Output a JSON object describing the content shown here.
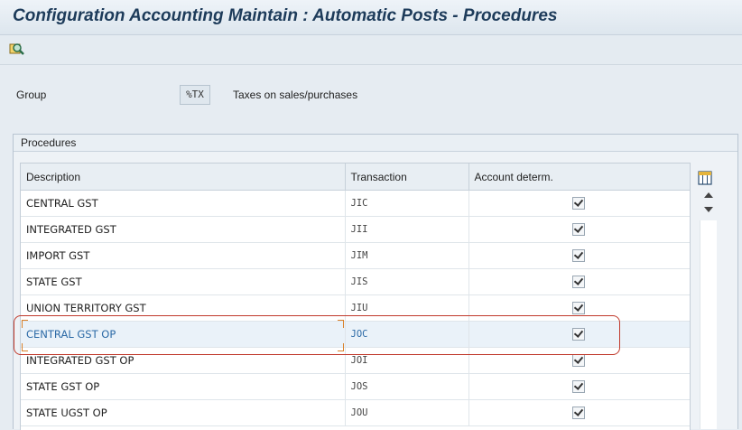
{
  "window": {
    "title": "Configuration Accounting Maintain : Automatic Posts - Procedures"
  },
  "toolbar": {
    "buttons": [
      {
        "icon": "find-icon"
      }
    ]
  },
  "group": {
    "label": "Group",
    "code": "%TX",
    "description": "Taxes on sales/purchases"
  },
  "procedures": {
    "title": "Procedures",
    "columns": [
      "Description",
      "Transaction",
      "Account determ."
    ],
    "rows": [
      {
        "description": "CENTRAL GST",
        "transaction": "JIC",
        "account_determ": true
      },
      {
        "description": "INTEGRATED GST",
        "transaction": "JII",
        "account_determ": true
      },
      {
        "description": "IMPORT GST",
        "transaction": "JIM",
        "account_determ": true
      },
      {
        "description": "STATE GST",
        "transaction": "JIS",
        "account_determ": true
      },
      {
        "description": "UNION TERRITORY GST",
        "transaction": "JIU",
        "account_determ": true
      },
      {
        "description": "CENTRAL GST OP",
        "transaction": "JOC",
        "account_determ": true,
        "selected": true
      },
      {
        "description": "INTEGRATED GST OP",
        "transaction": "JOI",
        "account_determ": true
      },
      {
        "description": "STATE GST OP",
        "transaction": "JOS",
        "account_determ": true
      },
      {
        "description": "STATE UGST OP",
        "transaction": "JOU",
        "account_determ": true
      }
    ]
  },
  "colors": {
    "title": "#1d3b5a",
    "selected_text": "#2c6aa6",
    "highlight_border": "#c0392b"
  }
}
